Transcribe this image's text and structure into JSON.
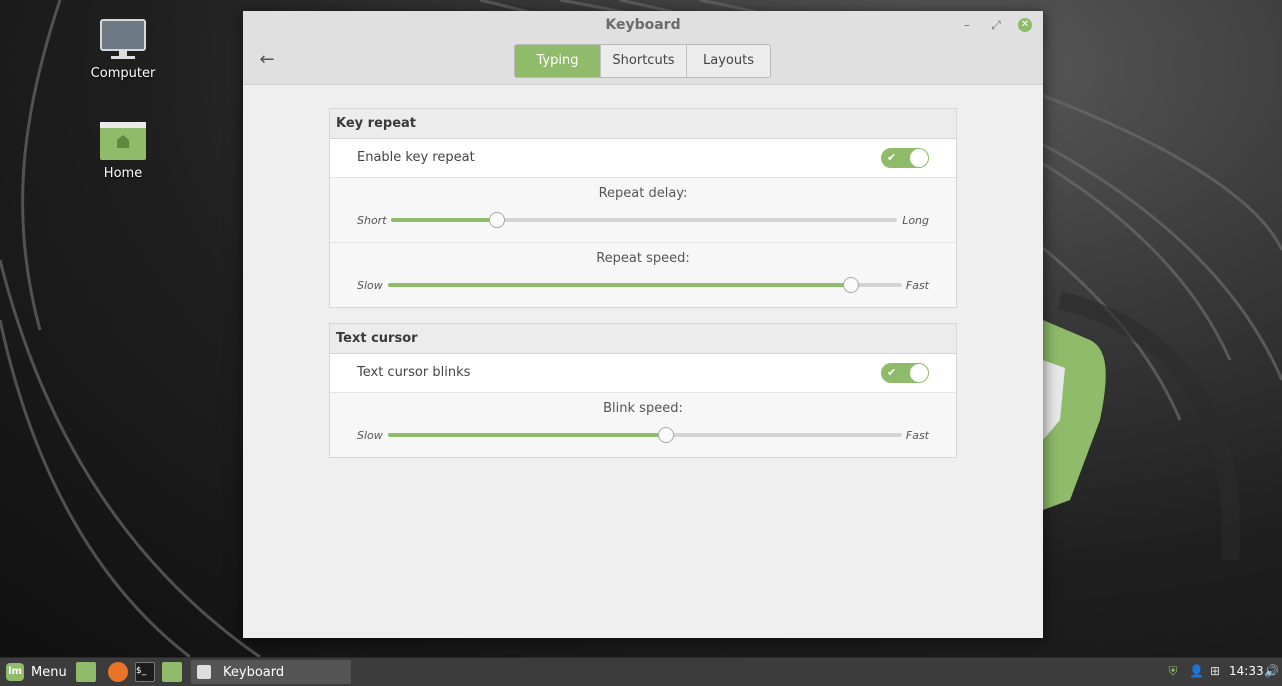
{
  "desktop": {
    "icons": [
      {
        "label": "Computer"
      },
      {
        "label": "Home"
      }
    ]
  },
  "window": {
    "title": "Keyboard",
    "tabs": [
      {
        "label": "Typing",
        "active": true
      },
      {
        "label": "Shortcuts",
        "active": false
      },
      {
        "label": "Layouts",
        "active": false
      }
    ]
  },
  "sections": {
    "key_repeat": {
      "header": "Key repeat",
      "enable_label": "Enable key repeat",
      "enable_on": true,
      "delay": {
        "title": "Repeat delay:",
        "min_label": "Short",
        "max_label": "Long",
        "value_fraction": 0.21
      },
      "speed": {
        "title": "Repeat speed:",
        "min_label": "Slow",
        "max_label": "Fast",
        "value_fraction": 0.9
      }
    },
    "text_cursor": {
      "header": "Text cursor",
      "blink_label": "Text cursor blinks",
      "blink_on": true,
      "blink_speed": {
        "title": "Blink speed:",
        "min_label": "Slow",
        "max_label": "Fast",
        "value_fraction": 0.54
      }
    }
  },
  "panel": {
    "menu_label": "Menu",
    "task_label": "Keyboard",
    "clock": "14:33"
  },
  "colors": {
    "accent": "#8fbb6a",
    "panel": "#3c3c3c"
  }
}
